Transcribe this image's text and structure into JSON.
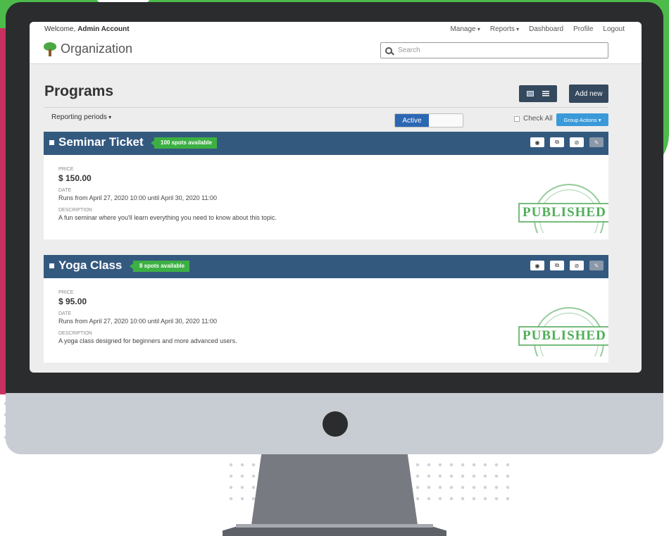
{
  "header": {
    "welcome_prefix": "Welcome,",
    "user_name": "Admin Account",
    "nav": [
      "Manage",
      "Reports",
      "Dashboard",
      "Profile",
      "Logout"
    ],
    "org_name": "Organization",
    "search_placeholder": "Search"
  },
  "page": {
    "title": "Programs",
    "add_new": "Add new",
    "reporting_periods": "Reporting periods",
    "status_filter": "Active",
    "check_all": "Check All",
    "group_actions": "Group Actions"
  },
  "labels": {
    "price": "PRICE",
    "date": "DATE",
    "description": "DESCRIPTION",
    "stamp": "PUBLISHED"
  },
  "programs": [
    {
      "title": "Seminar Ticket",
      "badge": "100 spots available",
      "price": "$ 150.00",
      "date": "Runs from April 27, 2020 10:00 until April 30, 2020 11:00",
      "description": "A fun seminar where you'll learn everything you need to know about this topic."
    },
    {
      "title": "Yoga Class",
      "badge": "8 spots available",
      "price": "$ 95.00",
      "date": "Runs from April 27, 2020 10:00 until April 30, 2020 11:00",
      "description": "A yoga class designed for beginners and more advanced users."
    }
  ],
  "icons": {
    "view": "eye-icon",
    "copy": "copy-icon",
    "disable": "block-icon",
    "edit": "pencil-icon",
    "card_view": "card-view-icon",
    "list_view": "list-view-icon",
    "search": "search-icon",
    "logo": "tree-icon"
  },
  "colors": {
    "header_bar": "#34597f",
    "badge": "#3cb043",
    "primary_button": "#34495e",
    "active_toggle": "#2c67b4",
    "group_actions": "#3a9ad9"
  }
}
